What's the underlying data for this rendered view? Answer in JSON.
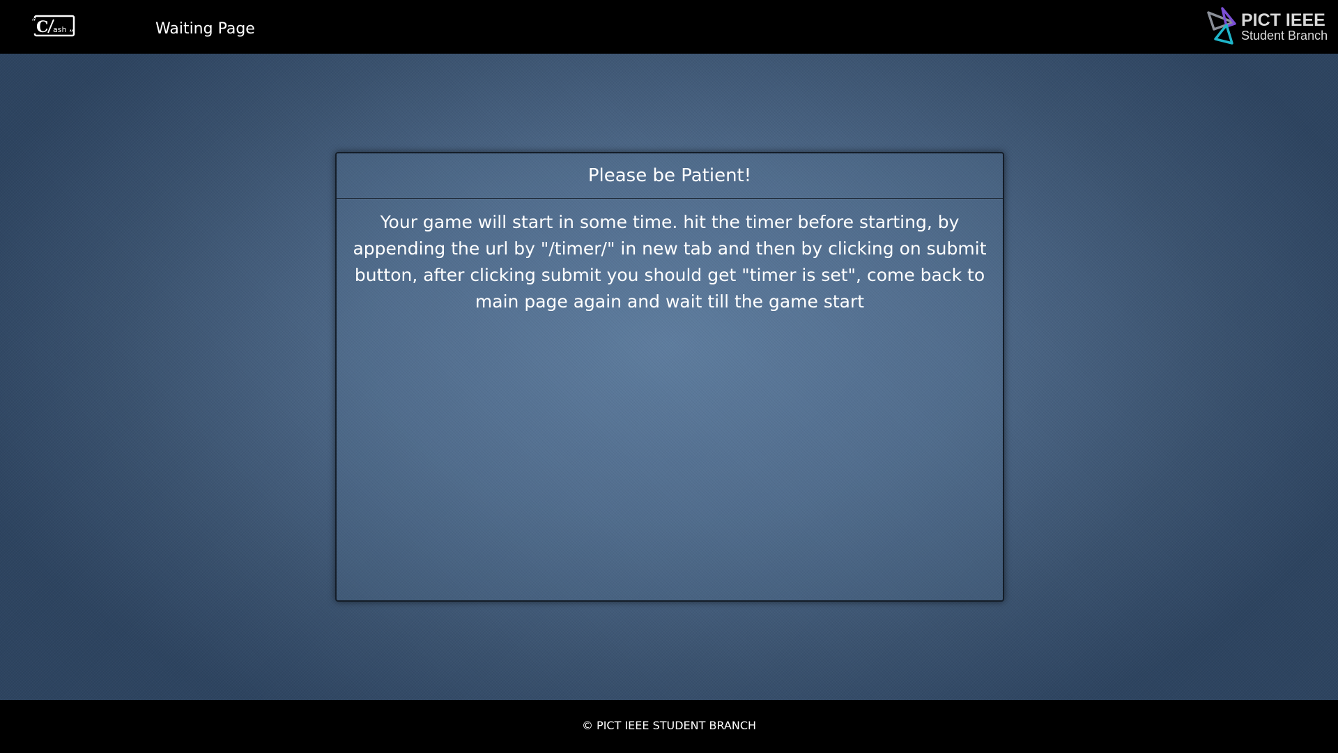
{
  "header": {
    "logo_text": "Clash",
    "page_title": "Waiting Page",
    "org_logo": {
      "name": "PICT IEEE",
      "subtitle": "Student Branch"
    }
  },
  "panel": {
    "heading": "Please be Patient!",
    "message": "Your game will start in some time. hit the timer before starting, by appending the url by \"/timer/\" in new tab and then by clicking on submit button, after clicking submit you should get \"timer is set\", come back to main page again and wait till the game start"
  },
  "footer": {
    "copyright": "© PICT IEEE STUDENT BRANCH"
  },
  "colors": {
    "bar_background": "#000000",
    "page_background": "#4f6a8a",
    "text": "#ffffff",
    "logo_purple": "#7b4fd6",
    "logo_teal": "#1fb5c9"
  }
}
